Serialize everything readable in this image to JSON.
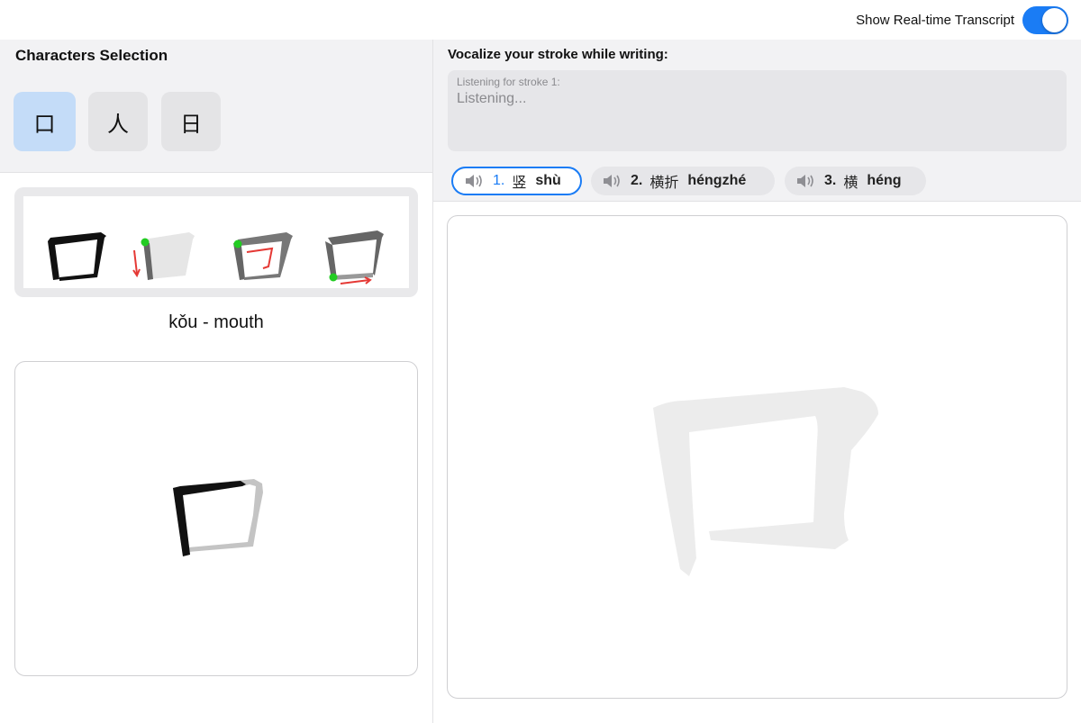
{
  "topbar": {
    "transcript_toggle_label": "Show Real-time Transcript",
    "transcript_toggle_on": true
  },
  "left": {
    "section_title": "Characters Selection",
    "characters": [
      {
        "char": "口",
        "selected": true
      },
      {
        "char": "人",
        "selected": false
      },
      {
        "char": "日",
        "selected": false
      }
    ],
    "meaning": "kǒu - mouth"
  },
  "right": {
    "vocalize_title": "Vocalize your stroke while writing:",
    "transcript_label": "Listening for stroke 1:",
    "transcript_text": "Listening...",
    "strokes": [
      {
        "num": "1.",
        "hanzi": "竖",
        "pinyin": "shù",
        "active": true
      },
      {
        "num": "2.",
        "hanzi": "横折",
        "pinyin": "héngzhé",
        "active": false
      },
      {
        "num": "3.",
        "hanzi": "横",
        "pinyin": "héng",
        "active": false
      }
    ]
  },
  "colors": {
    "accent": "#1a7cf5",
    "selected_char_bg": "#c4dcf8",
    "panel_bg": "#f2f2f4",
    "stroke_hint_red": "#e53935",
    "stroke_start_green": "#22cc22"
  },
  "icons": [
    "speaker-icon"
  ]
}
